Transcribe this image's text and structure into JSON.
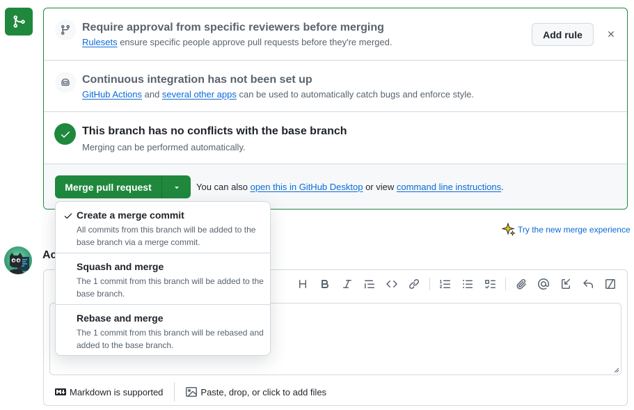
{
  "rules": {
    "title": "Require approval from specific reviewers before merging",
    "link": "Rulesets",
    "desc": " ensure specific people approve pull requests before they're merged.",
    "add_rule_label": "Add rule"
  },
  "ci": {
    "title": "Continuous integration has not been set up",
    "link1": "GitHub Actions",
    "mid": " and ",
    "link2": "several other apps",
    "desc": " can be used to automatically catch bugs and enforce style."
  },
  "conflicts": {
    "title": "This branch has no conflicts with the base branch",
    "desc": "Merging can be performed automatically."
  },
  "merge": {
    "button_label": "Merge pull request",
    "also_prefix": "You can also ",
    "desktop_link": "open this in GitHub Desktop",
    "or_view": " or view ",
    "cli_link": "command line instructions",
    "period": "."
  },
  "dropdown": {
    "items": [
      {
        "title": "Create a merge commit",
        "desc": "All commits from this branch will be added to the base branch via a merge commit.",
        "selected": true
      },
      {
        "title": "Squash and merge",
        "desc": "The 1 commit from this branch will be added to the base branch.",
        "selected": false
      },
      {
        "title": "Rebase and merge",
        "desc": "The 1 commit from this branch will be rebased and added to the base branch.",
        "selected": false
      }
    ]
  },
  "try_new": "Try the new merge experience",
  "comment": {
    "heading_partial": "Ac",
    "markdown_label": "Markdown is supported",
    "attach_label": "Paste, drop, or click to add files"
  },
  "colors": {
    "green": "#1f883d",
    "link": "#0969da",
    "muted": "#59636e",
    "border": "#d1d9e0"
  },
  "icons": [
    "git-merge-icon",
    "git-branch-icon",
    "copilot-bot-icon",
    "check-icon",
    "triangle-down-icon",
    "x-icon",
    "sparkles-icon",
    "heading-icon",
    "bold-icon",
    "italic-icon",
    "quote-icon",
    "code-icon",
    "link-icon",
    "ordered-list-icon",
    "unordered-list-icon",
    "task-list-icon",
    "paperclip-icon",
    "mention-icon",
    "cross-reference-icon",
    "reply-icon",
    "slash-command-icon",
    "markdown-icon",
    "image-icon"
  ]
}
